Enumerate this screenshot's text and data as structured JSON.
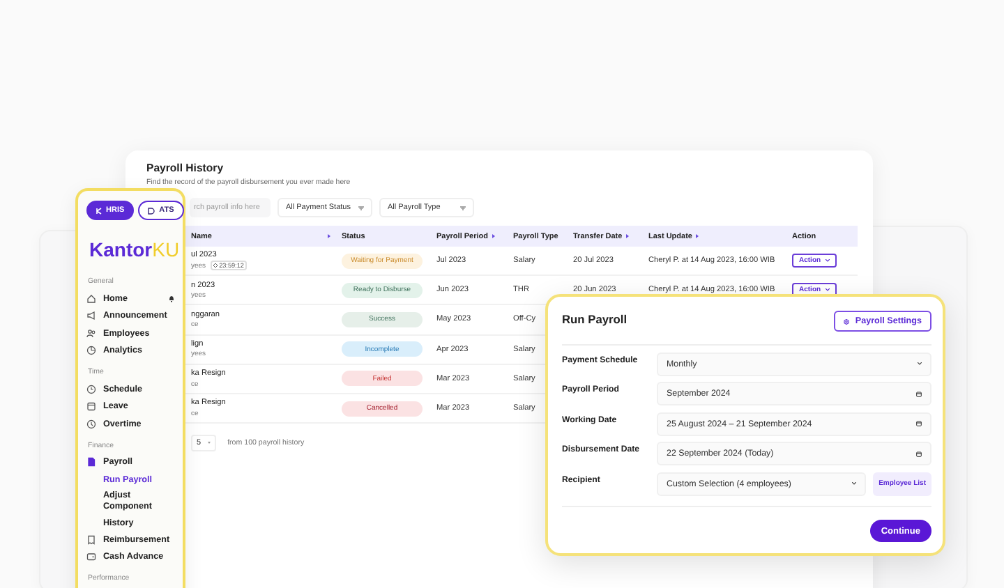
{
  "sidebar": {
    "apps": [
      {
        "label": "HRIS",
        "selected": true
      },
      {
        "label": "ATS",
        "selected": false
      }
    ],
    "logo": {
      "main": "Kantor",
      "accent": "KU"
    },
    "sections": [
      {
        "title": "General",
        "items": [
          {
            "label": "Home",
            "selected": false
          },
          {
            "label": "Announcement",
            "selected": false
          },
          {
            "label": "Employees",
            "selected": false
          },
          {
            "label": "Analytics",
            "selected": false
          }
        ]
      },
      {
        "title": "Time",
        "items": [
          {
            "label": "Schedule",
            "selected": false
          },
          {
            "label": "Leave",
            "selected": false
          },
          {
            "label": "Overtime",
            "selected": false
          }
        ]
      },
      {
        "title": "Finance",
        "items": [
          {
            "label": "Payroll",
            "selected": false,
            "expanded": true,
            "children": [
              {
                "label": "Run Payroll",
                "selected": true
              },
              {
                "label": "Adjust Component",
                "selected": false
              },
              {
                "label": "History",
                "selected": false
              }
            ]
          },
          {
            "label": "Reimbursement",
            "selected": false
          },
          {
            "label": "Cash Advance",
            "selected": false
          }
        ]
      },
      {
        "title": "Performance"
      }
    ]
  },
  "history": {
    "title": "Payroll History",
    "subtitle": "Find the record of the payroll disbursement you ever made here",
    "search": {
      "placeholder": "rch payroll info here"
    },
    "filters": [
      "All Payment Status",
      "All Payroll Type"
    ],
    "table": {
      "columns": [
        {
          "label": "Name",
          "sortable": true
        },
        {
          "label": "Status",
          "sortable": false
        },
        {
          "label": "Payroll Period",
          "sortable": true
        },
        {
          "label": "Payroll Type",
          "sortable": false
        },
        {
          "label": "Transfer Date",
          "sortable": true
        },
        {
          "label": "Last Update",
          "sortable": true
        },
        {
          "label": "Action",
          "sortable": false
        }
      ],
      "rows": [
        {
          "name": "ul 2023",
          "detail": "yees",
          "timer": "23:59:12",
          "status": {
            "label": "Waiting for Payment",
            "kind": "waiting"
          },
          "period": "Jul 2023",
          "type": "Salary",
          "transfer_date": "20 Jul 2023",
          "last_update": "Cheryl P. at 14 Aug 2023, 16:00 WIB",
          "action": "Action"
        },
        {
          "name": "n 2023",
          "detail": "yees",
          "status": {
            "label": "Ready to Disburse",
            "kind": "ready"
          },
          "period": "Jun 2023",
          "type": "THR",
          "transfer_date": "20 Jun 2023",
          "last_update": "Cheryl P. at 14 Aug 2023, 16:00 WIB",
          "action": "Action"
        },
        {
          "name": "nggaran",
          "detail": "ce",
          "status": {
            "label": "Success",
            "kind": "success"
          },
          "period": "May 2023",
          "type": "Off-Cy"
        },
        {
          "name": "lign",
          "detail": "yees",
          "status": {
            "label": "Incomplete",
            "kind": "incomplete"
          },
          "period": "Apr 2023",
          "type": "Salary"
        },
        {
          "name": "ka Resign",
          "detail": "ce",
          "status": {
            "label": "Failed",
            "kind": "failed"
          },
          "period": "Mar 2023",
          "type": "Salary"
        },
        {
          "name": "ka Resign",
          "detail": "ce",
          "status": {
            "label": "Cancelled",
            "kind": "cancelled"
          },
          "period": "Mar 2023",
          "type": "Salary"
        }
      ]
    },
    "pagination": {
      "page_size": "5",
      "summary": "from 100 payroll history"
    }
  },
  "run_payroll": {
    "title": "Run Payroll",
    "settings_button": "Payroll Settings",
    "fields": [
      {
        "label": "Payment Schedule",
        "kind": "select",
        "value": "Monthly"
      },
      {
        "label": "Payroll Period",
        "kind": "date",
        "value": "September 2024"
      },
      {
        "label": "Working Date",
        "kind": "date",
        "value": "25 August 2024 – 21 September 2024"
      },
      {
        "label": "Disbursement Date",
        "kind": "date",
        "value": "22 September 2024 (Today)"
      },
      {
        "label": "Recipient",
        "kind": "select",
        "value": "Custom Selection (4 employees)",
        "button": "Employee List"
      }
    ],
    "continue_button": "Continue"
  }
}
